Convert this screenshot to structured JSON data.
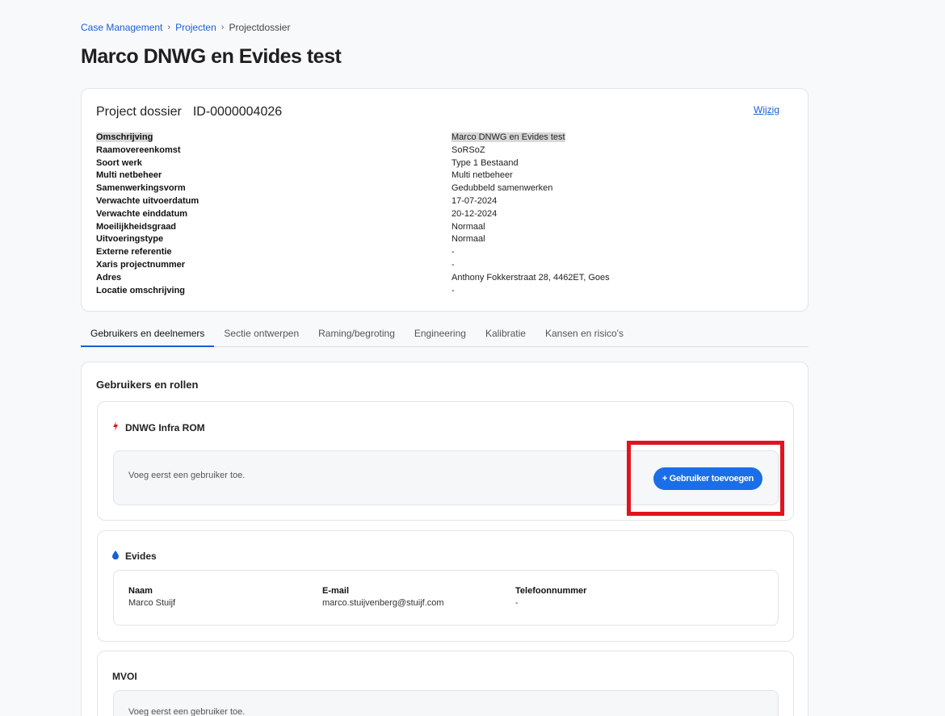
{
  "breadcrumb": {
    "item1": "Case Management",
    "item2": "Projecten",
    "item3": "Projectdossier",
    "separator": "›"
  },
  "page_title": "Marco DNWG en Evides test",
  "dossier": {
    "title": "Project dossier",
    "id": "ID-0000004026",
    "edit_label": "Wijzig",
    "fields": [
      {
        "label": "Omschrijving",
        "value": "Marco DNWG en Evides test"
      },
      {
        "label": "Raamovereenkomst",
        "value": "SoRSoZ"
      },
      {
        "label": "Soort werk",
        "value": "Type 1 Bestaand"
      },
      {
        "label": "Multi netbeheer",
        "value": "Multi netbeheer"
      },
      {
        "label": "Samenwerkingsvorm",
        "value": "Gedubbeld samenwerken"
      },
      {
        "label": "Verwachte uitvoerdatum",
        "value": "17-07-2024"
      },
      {
        "label": "Verwachte einddatum",
        "value": "20-12-2024"
      },
      {
        "label": "Moeilijkheidsgraad",
        "value": "Normaal"
      },
      {
        "label": "Uitvoeringstype",
        "value": "Normaal"
      },
      {
        "label": "Externe referentie",
        "value": "-"
      },
      {
        "label": "Xaris projectnummer",
        "value": "-"
      },
      {
        "label": "Adres",
        "value": "Anthony Fokkerstraat 28, 4462ET, Goes"
      },
      {
        "label": "Locatie omschrijving",
        "value": "-"
      }
    ]
  },
  "tabs": [
    {
      "label": "Gebruikers en deelnemers",
      "active": true
    },
    {
      "label": "Sectie ontwerpen"
    },
    {
      "label": "Raming/begroting"
    },
    {
      "label": "Engineering"
    },
    {
      "label": "Kalibratie"
    },
    {
      "label": "Kansen en risico's"
    }
  ],
  "users_section": {
    "title": "Gebruikers en rollen",
    "groups": [
      {
        "name": "DNWG Infra ROM",
        "icon": "lightning-icon",
        "icon_color": "#e0141e",
        "empty_text": "Voeg eerst een gebruiker toe.",
        "add_button": "+ Gebruiker toevoegen"
      },
      {
        "name": "Evides",
        "icon": "water-drop-icon",
        "icon_color": "#1a5fd6",
        "columns": [
          "Naam",
          "E-mail",
          "Telefoonnummer"
        ],
        "users": [
          {
            "name": "Marco Stuijf",
            "email": "marco.stuijvenberg@stuijf.com",
            "phone": "-"
          }
        ]
      },
      {
        "name": "MVOI",
        "empty_text": "Voeg eerst een gebruiker toe."
      }
    ]
  },
  "colors": {
    "accent": "#1a6ee8",
    "highlight_box": "#e0141e"
  }
}
